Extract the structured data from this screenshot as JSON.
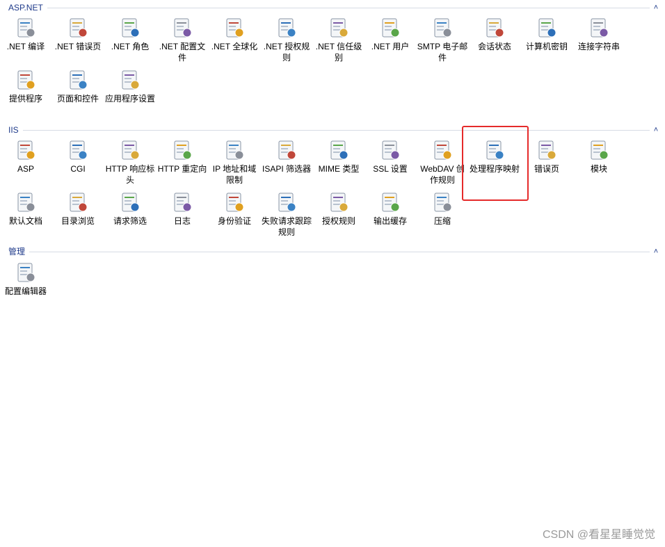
{
  "groups": [
    {
      "title": "ASP.NET",
      "items": [
        {
          "label": ".NET 编译",
          "icon": "dotnet-compile-icon"
        },
        {
          "label": ".NET 错误页",
          "icon": "dotnet-error-page-icon"
        },
        {
          "label": ".NET 角色",
          "icon": "dotnet-roles-icon"
        },
        {
          "label": ".NET 配置文件",
          "icon": "dotnet-profile-icon"
        },
        {
          "label": ".NET 全球化",
          "icon": "dotnet-globalization-icon"
        },
        {
          "label": ".NET 授权规则",
          "icon": "dotnet-authorization-icon"
        },
        {
          "label": ".NET 信任级别",
          "icon": "dotnet-trust-level-icon"
        },
        {
          "label": ".NET 用户",
          "icon": "dotnet-users-icon"
        },
        {
          "label": "SMTP 电子邮件",
          "icon": "smtp-email-icon"
        },
        {
          "label": "会话状态",
          "icon": "session-state-icon"
        },
        {
          "label": "计算机密钥",
          "icon": "machine-key-icon"
        },
        {
          "label": "连接字符串",
          "icon": "connection-strings-icon"
        },
        {
          "label": "提供程序",
          "icon": "providers-icon"
        },
        {
          "label": "页面和控件",
          "icon": "pages-controls-icon"
        },
        {
          "label": "应用程序设置",
          "icon": "app-settings-icon"
        }
      ]
    },
    {
      "title": "IIS",
      "items": [
        {
          "label": "ASP",
          "icon": "asp-icon"
        },
        {
          "label": "CGI",
          "icon": "cgi-icon"
        },
        {
          "label": "HTTP 响应标头",
          "icon": "http-response-headers-icon"
        },
        {
          "label": "HTTP 重定向",
          "icon": "http-redirect-icon"
        },
        {
          "label": "IP 地址和域限制",
          "icon": "ip-domain-restrictions-icon"
        },
        {
          "label": "ISAPI 筛选器",
          "icon": "isapi-filters-icon"
        },
        {
          "label": "MIME 类型",
          "icon": "mime-types-icon"
        },
        {
          "label": "SSL 设置",
          "icon": "ssl-settings-icon"
        },
        {
          "label": "WebDAV 创作规则",
          "icon": "webdav-icon"
        },
        {
          "label": "处理程序映射",
          "icon": "handler-mappings-icon"
        },
        {
          "label": "错误页",
          "icon": "error-pages-icon"
        },
        {
          "label": "模块",
          "icon": "modules-icon"
        },
        {
          "label": "默认文档",
          "icon": "default-document-icon"
        },
        {
          "label": "目录浏览",
          "icon": "directory-browsing-icon"
        },
        {
          "label": "请求筛选",
          "icon": "request-filtering-icon"
        },
        {
          "label": "日志",
          "icon": "logging-icon"
        },
        {
          "label": "身份验证",
          "icon": "authentication-icon"
        },
        {
          "label": "失败请求跟踪规则",
          "icon": "failed-request-tracing-icon"
        },
        {
          "label": "授权规则",
          "icon": "authorization-rules-icon"
        },
        {
          "label": "输出缓存",
          "icon": "output-caching-icon"
        },
        {
          "label": "压缩",
          "icon": "compression-icon"
        }
      ]
    },
    {
      "title": "管理",
      "items": [
        {
          "label": "配置编辑器",
          "icon": "configuration-editor-icon"
        }
      ]
    }
  ],
  "watermark": "CSDN @看星星睡觉觉",
  "colors": {
    "group_title": "#1e3a8a",
    "highlight": "#e52a2a"
  }
}
